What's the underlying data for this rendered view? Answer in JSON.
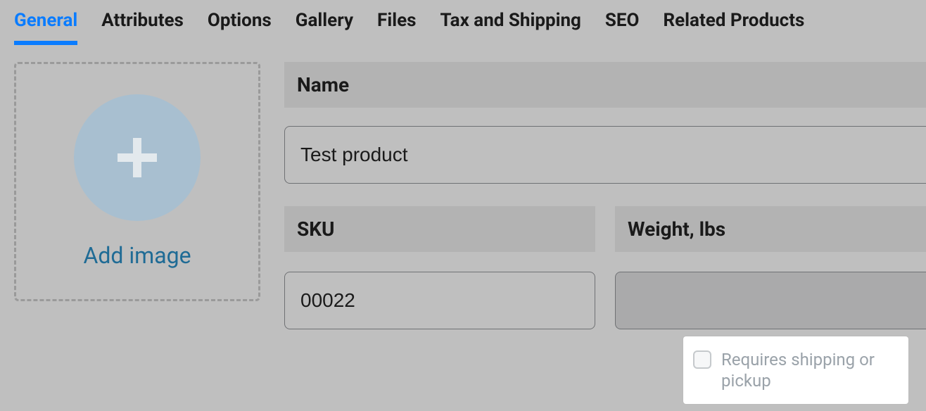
{
  "tabs": {
    "general": "General",
    "attributes": "Attributes",
    "options": "Options",
    "gallery": "Gallery",
    "files": "Files",
    "tax_shipping": "Tax and Shipping",
    "seo": "SEO",
    "related": "Related Products"
  },
  "uploader": {
    "add_image": "Add image"
  },
  "form": {
    "name_label": "Name",
    "name_value": "Test product",
    "sku_label": "SKU",
    "sku_value": "00022",
    "weight_label": "Weight, lbs",
    "weight_value": ""
  },
  "popover": {
    "requires_shipping": "Requires shipping or pickup"
  }
}
